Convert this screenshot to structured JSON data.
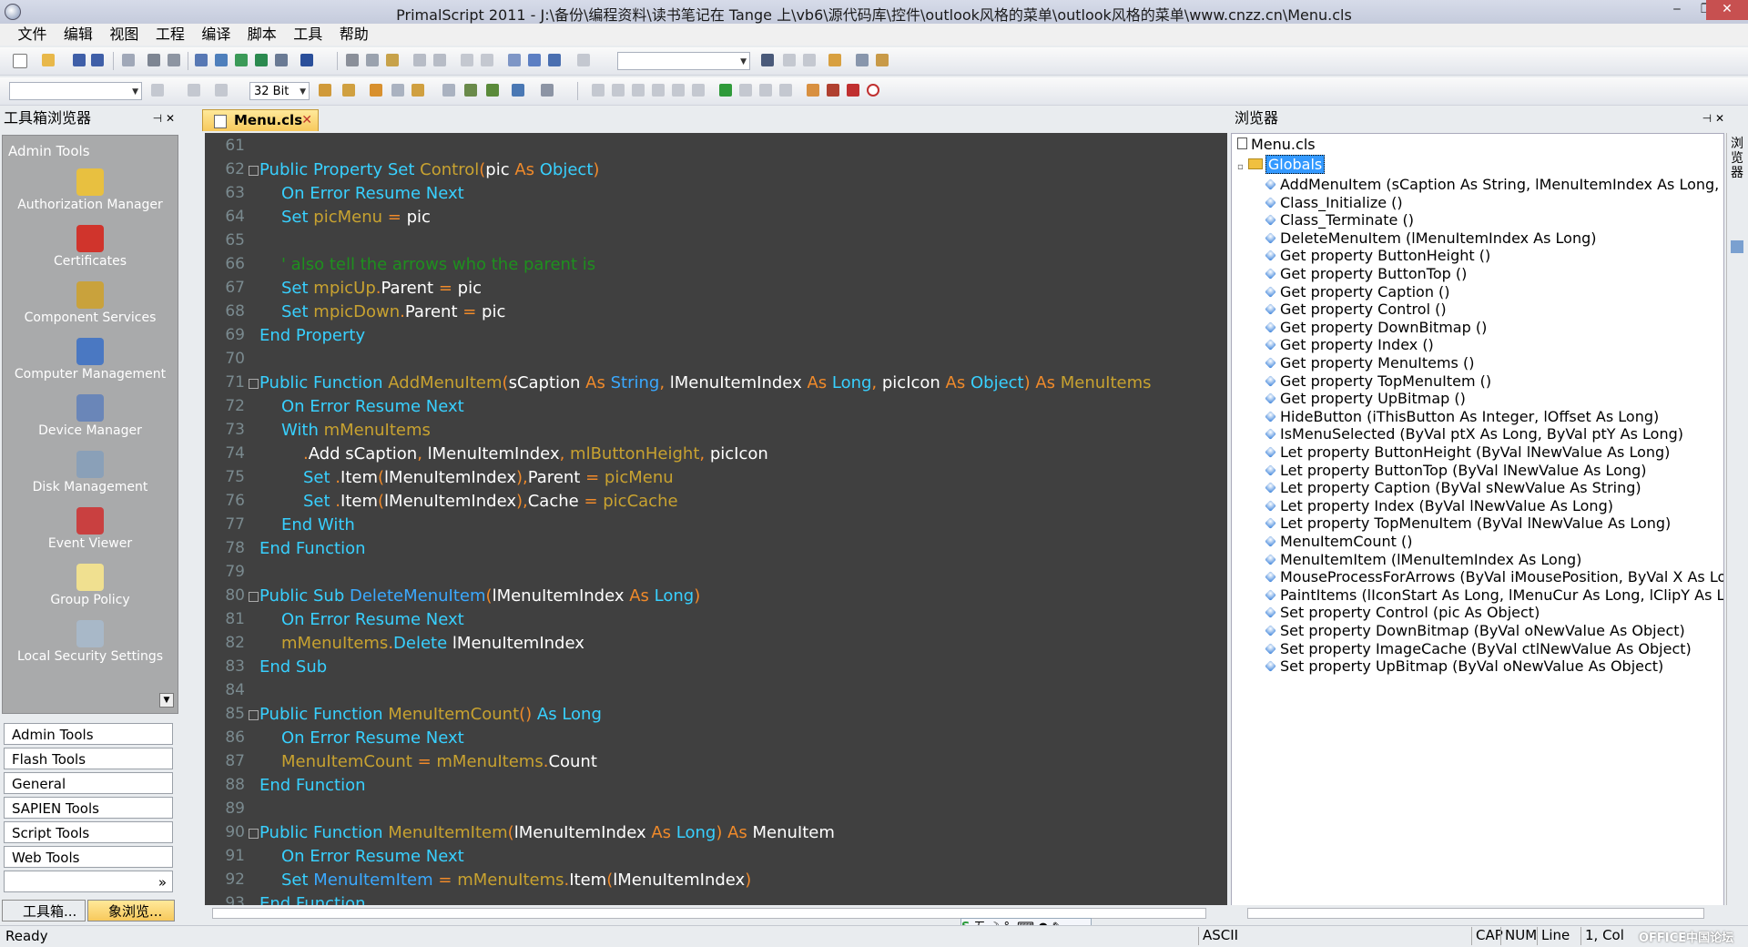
{
  "window": {
    "title": "PrimalScript 2011 - J:\\备份\\编程资料\\读书笔记在 Tange 上\\vb6\\源代码库\\控件\\outlook风格的菜单\\outlook风格的菜单\\www.cnzz.cn\\Menu.cls",
    "minimize": "‒",
    "maximize": "❐",
    "close": "✕"
  },
  "menubar": [
    "文件",
    "编辑",
    "视图",
    "工程",
    "编译",
    "脚本",
    "工具",
    "帮助"
  ],
  "toolbar2": {
    "bitness": "32 Bit"
  },
  "toolbox": {
    "title": "工具箱浏览器",
    "group": "Admin Tools",
    "tools": [
      {
        "label": "Authorization Manager",
        "icon": "authorization-manager-icon",
        "color": "#e8c040"
      },
      {
        "label": "Certificates",
        "icon": "certificates-icon",
        "color": "#d0342c"
      },
      {
        "label": "Component Services",
        "icon": "component-services-icon",
        "color": "#c9a23c"
      },
      {
        "label": "Computer Management",
        "icon": "computer-management-icon",
        "color": "#4a78c2"
      },
      {
        "label": "Device Manager",
        "icon": "device-manager-icon",
        "color": "#6a86b8"
      },
      {
        "label": "Disk Management",
        "icon": "disk-management-icon",
        "color": "#8aa0b8"
      },
      {
        "label": "Event Viewer",
        "icon": "event-viewer-icon",
        "color": "#c94040"
      },
      {
        "label": "Group Policy",
        "icon": "group-policy-icon",
        "color": "#f0e090"
      },
      {
        "label": "Local Security Settings",
        "icon": "local-security-settings-icon",
        "color": "#a8b8c8"
      }
    ],
    "tabs": [
      "Admin Tools",
      "Flash Tools",
      "General",
      "SAPIEN Tools",
      "Script Tools",
      "Web Tools"
    ],
    "bottom_tabs": [
      "工具箱...",
      "象浏览..."
    ]
  },
  "editor": {
    "tab": "Menu.cls",
    "lines": [
      {
        "n": 61,
        "fold": false,
        "indent": 0,
        "parts": []
      },
      {
        "n": 62,
        "fold": true,
        "indent": 0,
        "parts": [
          [
            "k",
            "Public Property Set "
          ],
          [
            "g",
            "Control"
          ],
          [
            "o",
            "("
          ],
          [
            "t",
            "pic "
          ],
          [
            "o",
            "As "
          ],
          [
            "k",
            "Object"
          ],
          [
            "o",
            ")"
          ]
        ]
      },
      {
        "n": 63,
        "fold": false,
        "indent": 1,
        "parts": [
          [
            "k",
            "On Error Resume Next"
          ]
        ]
      },
      {
        "n": 64,
        "fold": false,
        "indent": 1,
        "parts": [
          [
            "k",
            "Set "
          ],
          [
            "g",
            "picMenu "
          ],
          [
            "o",
            "= "
          ],
          [
            "t",
            "pic"
          ]
        ]
      },
      {
        "n": 65,
        "fold": false,
        "indent": 0,
        "parts": []
      },
      {
        "n": 66,
        "fold": false,
        "indent": 1,
        "parts": [
          [
            "c",
            "' also tell the arrows who the parent is"
          ]
        ]
      },
      {
        "n": 67,
        "fold": false,
        "indent": 1,
        "parts": [
          [
            "k",
            "Set "
          ],
          [
            "g",
            "mpicUp"
          ],
          [
            "o",
            "."
          ],
          [
            "t",
            "Parent "
          ],
          [
            "o",
            "= "
          ],
          [
            "t",
            "pic"
          ]
        ]
      },
      {
        "n": 68,
        "fold": false,
        "indent": 1,
        "parts": [
          [
            "k",
            "Set "
          ],
          [
            "g",
            "mpicDown"
          ],
          [
            "o",
            "."
          ],
          [
            "t",
            "Parent "
          ],
          [
            "o",
            "= "
          ],
          [
            "t",
            "pic"
          ]
        ]
      },
      {
        "n": 69,
        "fold": false,
        "indent": 0,
        "parts": [
          [
            "k",
            "End Property"
          ]
        ]
      },
      {
        "n": 70,
        "fold": false,
        "indent": 0,
        "parts": []
      },
      {
        "n": 71,
        "fold": true,
        "indent": 0,
        "parts": [
          [
            "k",
            "Public Function "
          ],
          [
            "g",
            "AddMenuItem"
          ],
          [
            "o",
            "("
          ],
          [
            "t",
            "sCaption "
          ],
          [
            "o",
            "As "
          ],
          [
            "s",
            "String"
          ],
          [
            "o",
            ", "
          ],
          [
            "t",
            "lMenuItemIndex "
          ],
          [
            "o",
            "As "
          ],
          [
            "k",
            "Long"
          ],
          [
            "o",
            ", "
          ],
          [
            "t",
            "picIcon "
          ],
          [
            "o",
            "As "
          ],
          [
            "k",
            "Object"
          ],
          [
            "o",
            ") As "
          ],
          [
            "g",
            "MenuItems"
          ]
        ]
      },
      {
        "n": 72,
        "fold": false,
        "indent": 1,
        "parts": [
          [
            "k",
            "On Error Resume Next"
          ]
        ]
      },
      {
        "n": 73,
        "fold": false,
        "indent": 1,
        "parts": [
          [
            "k",
            "With "
          ],
          [
            "g",
            "mMenuItems"
          ]
        ]
      },
      {
        "n": 74,
        "fold": false,
        "indent": 2,
        "parts": [
          [
            "o",
            "."
          ],
          [
            "t",
            "Add sCaption"
          ],
          [
            "o",
            ", "
          ],
          [
            "t",
            "lMenuItemIndex"
          ],
          [
            "o",
            ", "
          ],
          [
            "g",
            "mlButtonHeight"
          ],
          [
            "o",
            ", "
          ],
          [
            "t",
            "picIcon"
          ]
        ]
      },
      {
        "n": 75,
        "fold": false,
        "indent": 2,
        "parts": [
          [
            "k",
            "Set "
          ],
          [
            "o",
            "."
          ],
          [
            "t",
            "Item"
          ],
          [
            "o",
            "("
          ],
          [
            "t",
            "lMenuItemIndex"
          ],
          [
            "o",
            "),"
          ],
          [
            "t",
            "Parent "
          ],
          [
            "o",
            "= "
          ],
          [
            "g",
            "picMenu"
          ]
        ]
      },
      {
        "n": 76,
        "fold": false,
        "indent": 2,
        "parts": [
          [
            "k",
            "Set "
          ],
          [
            "o",
            "."
          ],
          [
            "t",
            "Item"
          ],
          [
            "o",
            "("
          ],
          [
            "t",
            "lMenuItemIndex"
          ],
          [
            "o",
            "),"
          ],
          [
            "t",
            "Cache "
          ],
          [
            "o",
            "= "
          ],
          [
            "g",
            "picCache"
          ]
        ]
      },
      {
        "n": 77,
        "fold": false,
        "indent": 1,
        "parts": [
          [
            "k",
            "End With"
          ]
        ]
      },
      {
        "n": 78,
        "fold": false,
        "indent": 0,
        "parts": [
          [
            "k",
            "End Function"
          ]
        ]
      },
      {
        "n": 79,
        "fold": false,
        "indent": 0,
        "parts": []
      },
      {
        "n": 80,
        "fold": true,
        "indent": 0,
        "parts": [
          [
            "k",
            "Public Sub "
          ],
          [
            "s",
            "DeleteMenuItem"
          ],
          [
            "o",
            "("
          ],
          [
            "t",
            "lMenuItemIndex "
          ],
          [
            "o",
            "As "
          ],
          [
            "k",
            "Long"
          ],
          [
            "o",
            ")"
          ]
        ]
      },
      {
        "n": 81,
        "fold": false,
        "indent": 1,
        "parts": [
          [
            "k",
            "On Error Resume Next"
          ]
        ]
      },
      {
        "n": 82,
        "fold": false,
        "indent": 1,
        "parts": [
          [
            "g",
            "mMenuItems"
          ],
          [
            "o",
            "."
          ],
          [
            "k",
            "Delete "
          ],
          [
            "t",
            "lMenuItemIndex"
          ]
        ]
      },
      {
        "n": 83,
        "fold": false,
        "indent": 0,
        "parts": [
          [
            "k",
            "End Sub"
          ]
        ]
      },
      {
        "n": 84,
        "fold": false,
        "indent": 0,
        "parts": []
      },
      {
        "n": 85,
        "fold": true,
        "indent": 0,
        "parts": [
          [
            "k",
            "Public Function "
          ],
          [
            "g",
            "MenuItemCount"
          ],
          [
            "o",
            "() "
          ],
          [
            "k",
            "As Long"
          ]
        ]
      },
      {
        "n": 86,
        "fold": false,
        "indent": 1,
        "parts": [
          [
            "k",
            "On Error Resume Next"
          ]
        ]
      },
      {
        "n": 87,
        "fold": false,
        "indent": 1,
        "parts": [
          [
            "g",
            "MenuItemCount "
          ],
          [
            "o",
            "= "
          ],
          [
            "g",
            "mMenuItems"
          ],
          [
            "o",
            "."
          ],
          [
            "t",
            "Count"
          ]
        ]
      },
      {
        "n": 88,
        "fold": false,
        "indent": 0,
        "parts": [
          [
            "k",
            "End Function"
          ]
        ]
      },
      {
        "n": 89,
        "fold": false,
        "indent": 0,
        "parts": []
      },
      {
        "n": 90,
        "fold": true,
        "indent": 0,
        "parts": [
          [
            "k",
            "Public Function "
          ],
          [
            "g",
            "MenuItemItem"
          ],
          [
            "o",
            "("
          ],
          [
            "t",
            "lMenuItemIndex "
          ],
          [
            "o",
            "As "
          ],
          [
            "k",
            "Long"
          ],
          [
            "o",
            ") As "
          ],
          [
            "t",
            "MenuItem"
          ]
        ]
      },
      {
        "n": 91,
        "fold": false,
        "indent": 1,
        "parts": [
          [
            "k",
            "On Error Resume Next"
          ]
        ]
      },
      {
        "n": 92,
        "fold": false,
        "indent": 1,
        "parts": [
          [
            "k",
            "Set "
          ],
          [
            "s",
            "MenuItemItem "
          ],
          [
            "o",
            "= "
          ],
          [
            "g",
            "mMenuItems"
          ],
          [
            "o",
            "."
          ],
          [
            "t",
            "Item"
          ],
          [
            "o",
            "("
          ],
          [
            "t",
            "lMenuItemIndex"
          ],
          [
            "o",
            ")"
          ]
        ]
      },
      {
        "n": 93,
        "fold": false,
        "indent": 0,
        "parts": [
          [
            "k",
            "End Function"
          ]
        ]
      }
    ]
  },
  "browser": {
    "title": "浏览器",
    "side_tab": "浏览器",
    "root": "Menu.cls",
    "globals": "Globals",
    "members": [
      "AddMenuItem (sCaption As String, lMenuItemIndex As Long, p",
      "Class_Initialize ()",
      "Class_Terminate ()",
      "DeleteMenuItem (lMenuItemIndex As Long)",
      "Get property ButtonHeight ()",
      "Get property ButtonTop ()",
      "Get property Caption ()",
      "Get property Control ()",
      "Get property DownBitmap ()",
      "Get property Index ()",
      "Get property MenuItems ()",
      "Get property TopMenuItem ()",
      "Get property UpBitmap ()",
      "HideButton (iThisButton As Integer, lOffset As Long)",
      "IsMenuSelected (ByVal ptX As Long, ByVal ptY As Long)",
      "Let property ButtonHeight (ByVal lNewValue As Long)",
      "Let property ButtonTop (ByVal lNewValue As Long)",
      "Let property Caption (ByVal sNewValue As String)",
      "Let property Index (ByVal lNewValue As Long)",
      "Let property TopMenuItem (ByVal lNewValue As Long)",
      "MenuItemCount ()",
      "MenuItemItem (lMenuItemIndex As Long)",
      "MouseProcessForArrows (ByVal iMousePosition, ByVal X As Long",
      "PaintItems (lIconStart As Long, lMenuCur As Long, lClipY As Lor",
      "Set property Control (pic As Object)",
      "Set property DownBitmap (ByVal oNewValue As Object)",
      "Set property ImageCache (ByVal ctlNewValue As Object)",
      "Set property UpBitmap (ByVal oNewValue As Object)"
    ]
  },
  "ime": {
    "label": "五"
  },
  "statusbar": {
    "status": "Ready",
    "encoding": "ASCII",
    "cap": "CAP",
    "num": "NUM",
    "line_label": "Line",
    "position": "1, Col"
  },
  "watermark": "OFFICE中国论坛"
}
